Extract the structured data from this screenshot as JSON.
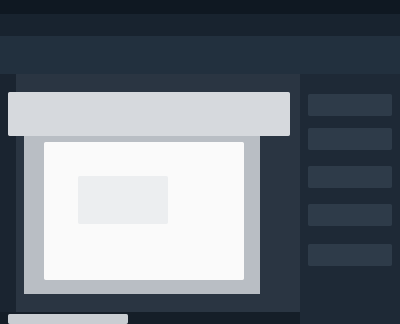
{
  "window": {
    "title": ""
  },
  "panel": {
    "title": ""
  },
  "right_panel": {
    "items": [
      "",
      "",
      "",
      "",
      ""
    ]
  },
  "status": {
    "text": ""
  },
  "colors": {
    "background": "#1b2633",
    "topbar": "#0f1822",
    "panel_header": "#d6d9dd",
    "canvas": "#fafafa"
  }
}
